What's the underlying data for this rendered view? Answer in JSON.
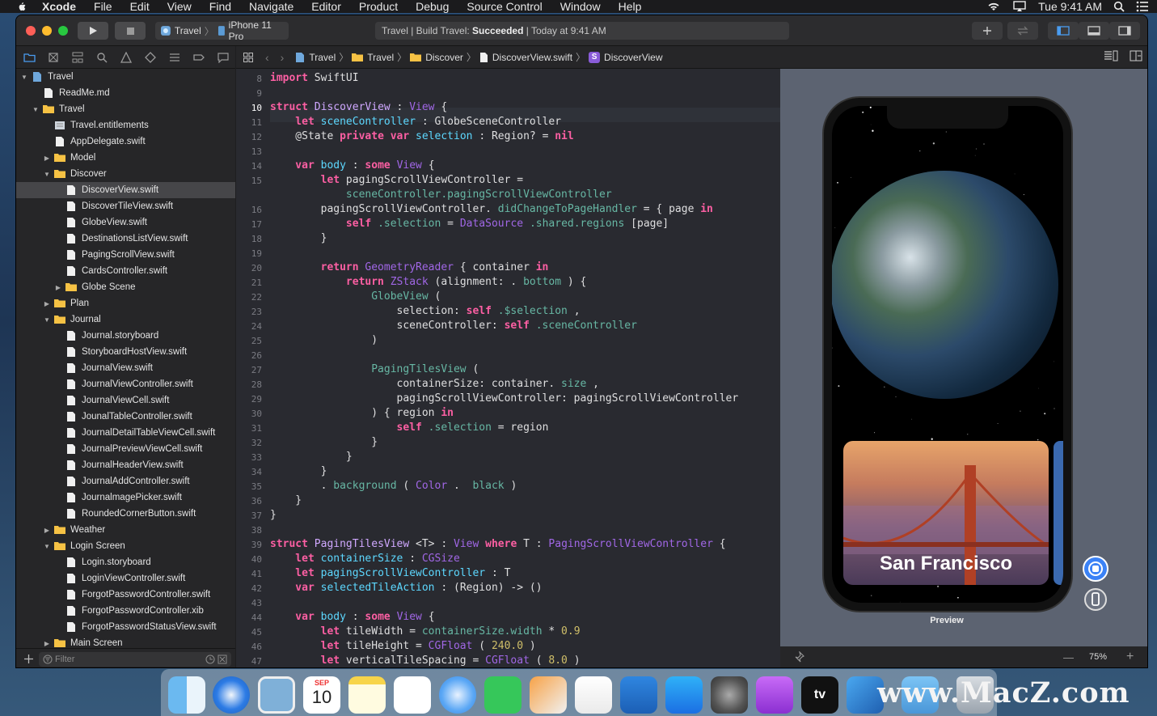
{
  "menubar": {
    "app": "Xcode",
    "items": [
      "File",
      "Edit",
      "View",
      "Find",
      "Navigate",
      "Editor",
      "Product",
      "Debug",
      "Source Control",
      "Window",
      "Help"
    ],
    "clock": "Tue 9:41 AM"
  },
  "toolbar": {
    "scheme": "Travel",
    "device": "iPhone 11 Pro",
    "activity_prefix": "Travel | Build Travel: ",
    "activity_status": "Succeeded",
    "activity_suffix": " | Today at 9:41 AM"
  },
  "jumpbar": {
    "crumbs": [
      "Travel",
      "Travel",
      "Discover",
      "DiscoverView.swift",
      "DiscoverView"
    ]
  },
  "navigator": {
    "items": [
      {
        "label": "Travel",
        "depth": 0,
        "disclosure": "open",
        "kind": "project"
      },
      {
        "label": "ReadMe.md",
        "depth": 1,
        "disclosure": "",
        "kind": "file"
      },
      {
        "label": "Travel",
        "depth": 1,
        "disclosure": "open",
        "kind": "folder"
      },
      {
        "label": "Travel.entitlements",
        "depth": 2,
        "disclosure": "",
        "kind": "ent"
      },
      {
        "label": "AppDelegate.swift",
        "depth": 2,
        "disclosure": "",
        "kind": "file"
      },
      {
        "label": "Model",
        "depth": 2,
        "disclosure": "closed",
        "kind": "folder"
      },
      {
        "label": "Discover",
        "depth": 2,
        "disclosure": "open",
        "kind": "folder"
      },
      {
        "label": "DiscoverView.swift",
        "depth": 3,
        "disclosure": "",
        "kind": "file",
        "selected": true
      },
      {
        "label": "DiscoverTileView.swift",
        "depth": 3,
        "disclosure": "",
        "kind": "file"
      },
      {
        "label": "GlobeView.swift",
        "depth": 3,
        "disclosure": "",
        "kind": "file"
      },
      {
        "label": "DestinationsListView.swift",
        "depth": 3,
        "disclosure": "",
        "kind": "file"
      },
      {
        "label": "PagingScrollView.swift",
        "depth": 3,
        "disclosure": "",
        "kind": "file"
      },
      {
        "label": "CardsController.swift",
        "depth": 3,
        "disclosure": "",
        "kind": "file"
      },
      {
        "label": "Globe Scene",
        "depth": 3,
        "disclosure": "closed",
        "kind": "folder"
      },
      {
        "label": "Plan",
        "depth": 2,
        "disclosure": "closed",
        "kind": "folder"
      },
      {
        "label": "Journal",
        "depth": 2,
        "disclosure": "open",
        "kind": "folder"
      },
      {
        "label": "Journal.storyboard",
        "depth": 3,
        "disclosure": "",
        "kind": "file"
      },
      {
        "label": "StoryboardHostView.swift",
        "depth": 3,
        "disclosure": "",
        "kind": "file"
      },
      {
        "label": "JournalView.swift",
        "depth": 3,
        "disclosure": "",
        "kind": "file"
      },
      {
        "label": "JournalViewController.swift",
        "depth": 3,
        "disclosure": "",
        "kind": "file"
      },
      {
        "label": "JournalViewCell.swift",
        "depth": 3,
        "disclosure": "",
        "kind": "file"
      },
      {
        "label": "JounalTableController.swift",
        "depth": 3,
        "disclosure": "",
        "kind": "file"
      },
      {
        "label": "JournalDetailTableViewCell.swift",
        "depth": 3,
        "disclosure": "",
        "kind": "file"
      },
      {
        "label": "JournalPreviewViewCell.swift",
        "depth": 3,
        "disclosure": "",
        "kind": "file"
      },
      {
        "label": "JournalHeaderView.swift",
        "depth": 3,
        "disclosure": "",
        "kind": "file"
      },
      {
        "label": "JournalAddController.swift",
        "depth": 3,
        "disclosure": "",
        "kind": "file"
      },
      {
        "label": "JournalmagePicker.swift",
        "depth": 3,
        "disclosure": "",
        "kind": "file"
      },
      {
        "label": "RoundedCornerButton.swift",
        "depth": 3,
        "disclosure": "",
        "kind": "file"
      },
      {
        "label": "Weather",
        "depth": 2,
        "disclosure": "closed",
        "kind": "folder"
      },
      {
        "label": "Login Screen",
        "depth": 2,
        "disclosure": "open",
        "kind": "folder"
      },
      {
        "label": "Login.storyboard",
        "depth": 3,
        "disclosure": "",
        "kind": "file"
      },
      {
        "label": "LoginViewController.swift",
        "depth": 3,
        "disclosure": "",
        "kind": "file"
      },
      {
        "label": "ForgotPasswordController.swift",
        "depth": 3,
        "disclosure": "",
        "kind": "file"
      },
      {
        "label": "ForgotPasswordController.xib",
        "depth": 3,
        "disclosure": "",
        "kind": "file"
      },
      {
        "label": "ForgotPasswordStatusView.swift",
        "depth": 3,
        "disclosure": "",
        "kind": "file"
      },
      {
        "label": "Main Screen",
        "depth": 2,
        "disclosure": "closed",
        "kind": "folder"
      }
    ],
    "filter_placeholder": "Filter"
  },
  "editor": {
    "current_line": 10,
    "lines": [
      {
        "n": "8",
        "segs": [
          [
            "kw",
            "import"
          ],
          [
            "",
            "SwiftUI"
          ]
        ]
      },
      {
        "n": "9",
        "segs": []
      },
      {
        "n": "10",
        "segs": [
          [
            "kw",
            "struct"
          ],
          [
            "ty",
            "DiscoverView"
          ],
          [
            "",
            ":"
          ],
          [
            "pr",
            "View"
          ],
          [
            "",
            "{"
          ]
        ]
      },
      {
        "n": "11",
        "segs": [
          [
            "kw",
            "    let"
          ],
          [
            "dc",
            "sceneController"
          ],
          [
            "",
            ": GlobeSceneController"
          ]
        ]
      },
      {
        "n": "12",
        "segs": [
          [
            "",
            "    @State"
          ],
          [
            "kw",
            "private var"
          ],
          [
            "dc",
            "selection"
          ],
          [
            "",
            ": Region? ="
          ],
          [
            "kw",
            "nil"
          ]
        ]
      },
      {
        "n": "13",
        "segs": []
      },
      {
        "n": "14",
        "segs": [
          [
            "kw",
            "    var"
          ],
          [
            "dc",
            "body"
          ],
          [
            "",
            ":"
          ],
          [
            "kw",
            "some"
          ],
          [
            "pr",
            "View"
          ],
          [
            "",
            "{"
          ]
        ]
      },
      {
        "n": "15",
        "segs": [
          [
            "kw",
            "        let"
          ],
          [
            "",
            "pagingScrollViewController ="
          ]
        ]
      },
      {
        "n": "",
        "segs": [
          [
            "fn",
            "            sceneController.pagingScrollViewController"
          ]
        ]
      },
      {
        "n": "16",
        "segs": [
          [
            "",
            "        pagingScrollViewController."
          ],
          [
            "fn",
            "didChangeToPageHandler"
          ],
          [
            "",
            "= { page"
          ],
          [
            "kw",
            "in"
          ]
        ]
      },
      {
        "n": "17",
        "segs": [
          [
            "kw",
            "            self"
          ],
          [
            "fn",
            ".selection"
          ],
          [
            "",
            "="
          ],
          [
            "pr",
            "DataSource"
          ],
          [
            "fn",
            ".shared.regions"
          ],
          [
            "",
            "[page]"
          ]
        ]
      },
      {
        "n": "18",
        "segs": [
          [
            "",
            "        }"
          ]
        ]
      },
      {
        "n": "19",
        "segs": []
      },
      {
        "n": "20",
        "segs": [
          [
            "kw",
            "        return"
          ],
          [
            "pr",
            "GeometryReader"
          ],
          [
            "",
            "{ container"
          ],
          [
            "kw",
            "in"
          ]
        ]
      },
      {
        "n": "21",
        "segs": [
          [
            "kw",
            "            return"
          ],
          [
            "pr",
            "ZStack"
          ],
          [
            "",
            "(alignment: ."
          ],
          [
            "fn",
            "bottom"
          ],
          [
            "",
            ") {"
          ]
        ]
      },
      {
        "n": "22",
        "segs": [
          [
            "fn",
            "                GlobeView"
          ],
          [
            "",
            "("
          ]
        ]
      },
      {
        "n": "23",
        "segs": [
          [
            "",
            "                    selection:"
          ],
          [
            "kw",
            "self"
          ],
          [
            "fn",
            ".$selection"
          ],
          [
            "",
            ","
          ]
        ]
      },
      {
        "n": "24",
        "segs": [
          [
            "",
            "                    sceneController:"
          ],
          [
            "kw",
            "self"
          ],
          [
            "fn",
            ".sceneController"
          ]
        ]
      },
      {
        "n": "25",
        "segs": [
          [
            "",
            "                )"
          ]
        ]
      },
      {
        "n": "26",
        "segs": []
      },
      {
        "n": "27",
        "segs": [
          [
            "fn",
            "                PagingTilesView"
          ],
          [
            "",
            "("
          ]
        ]
      },
      {
        "n": "28",
        "segs": [
          [
            "",
            "                    containerSize: container."
          ],
          [
            "fn",
            "size"
          ],
          [
            "",
            ","
          ]
        ]
      },
      {
        "n": "29",
        "segs": [
          [
            "",
            "                    pagingScrollViewController: pagingScrollViewController"
          ]
        ]
      },
      {
        "n": "30",
        "segs": [
          [
            "",
            "                ) { region"
          ],
          [
            "kw",
            "in"
          ]
        ]
      },
      {
        "n": "31",
        "segs": [
          [
            "kw",
            "                    self"
          ],
          [
            "fn",
            ".selection"
          ],
          [
            "",
            "= region"
          ]
        ]
      },
      {
        "n": "32",
        "segs": [
          [
            "",
            "                }"
          ]
        ]
      },
      {
        "n": "33",
        "segs": [
          [
            "",
            "            }"
          ]
        ]
      },
      {
        "n": "34",
        "segs": [
          [
            "",
            "        }"
          ]
        ]
      },
      {
        "n": "35",
        "segs": [
          [
            "",
            "        ."
          ],
          [
            "fn",
            "background"
          ],
          [
            "",
            "("
          ],
          [
            "pr",
            "Color"
          ],
          [
            "",
            ". "
          ],
          [
            "fn",
            "black"
          ],
          [
            "",
            ")"
          ]
        ]
      },
      {
        "n": "36",
        "segs": [
          [
            "",
            "    }"
          ]
        ]
      },
      {
        "n": "37",
        "segs": [
          [
            "",
            "}"
          ]
        ]
      },
      {
        "n": "38",
        "segs": []
      },
      {
        "n": "39",
        "segs": [
          [
            "kw",
            "struct"
          ],
          [
            "ty",
            "PagingTilesView"
          ],
          [
            "",
            "<T> :"
          ],
          [
            "pr",
            "View"
          ],
          [
            "kw",
            "where"
          ],
          [
            "",
            "T :"
          ],
          [
            "pr",
            "PagingScrollViewController"
          ],
          [
            "",
            "{"
          ]
        ]
      },
      {
        "n": "40",
        "segs": [
          [
            "kw",
            "    let"
          ],
          [
            "dc",
            "containerSize"
          ],
          [
            "",
            ":"
          ],
          [
            "pr",
            "CGSize"
          ]
        ]
      },
      {
        "n": "41",
        "segs": [
          [
            "kw",
            "    let"
          ],
          [
            "dc",
            "pagingScrollViewController"
          ],
          [
            "",
            ": T"
          ]
        ]
      },
      {
        "n": "42",
        "segs": [
          [
            "kw",
            "    var"
          ],
          [
            "dc",
            "selectedTileAction"
          ],
          [
            "",
            ": (Region) -> ()"
          ]
        ]
      },
      {
        "n": "43",
        "segs": []
      },
      {
        "n": "44",
        "segs": [
          [
            "kw",
            "    var"
          ],
          [
            "dc",
            "body"
          ],
          [
            "",
            ":"
          ],
          [
            "kw",
            "some"
          ],
          [
            "pr",
            "View"
          ],
          [
            "",
            "{"
          ]
        ]
      },
      {
        "n": "45",
        "segs": [
          [
            "kw",
            "        let"
          ],
          [
            "",
            "tileWidth ="
          ],
          [
            "fn",
            "containerSize.width"
          ],
          [
            "",
            "*"
          ],
          [
            "nm",
            "0.9"
          ]
        ]
      },
      {
        "n": "46",
        "segs": [
          [
            "kw",
            "        let"
          ],
          [
            "",
            "tileHeight ="
          ],
          [
            "pr",
            "CGFloat"
          ],
          [
            "",
            "("
          ],
          [
            "nm",
            "240.0"
          ],
          [
            "",
            ")"
          ]
        ]
      },
      {
        "n": "47",
        "segs": [
          [
            "kw",
            "        let"
          ],
          [
            "",
            "verticalTileSpacing ="
          ],
          [
            "pr",
            "CGFloat"
          ],
          [
            "",
            "("
          ],
          [
            "nm",
            "8.0"
          ],
          [
            "",
            ")"
          ]
        ]
      }
    ]
  },
  "preview": {
    "card_title": "San Francisco",
    "label": "Preview",
    "zoom": "75%"
  },
  "dock": {
    "calendar_month": "SEP",
    "calendar_day": "10",
    "tv_label": "tv"
  },
  "watermark": "www.MacZ.com",
  "colors": {
    "keyword": "#fc5fa3",
    "type": "#d0a8ff",
    "project_type": "#a167e6",
    "number": "#d0bf69",
    "declaration": "#5dd8ff",
    "function": "#67b7a4",
    "plain": "#dfdfe0",
    "selection": "#464649"
  }
}
